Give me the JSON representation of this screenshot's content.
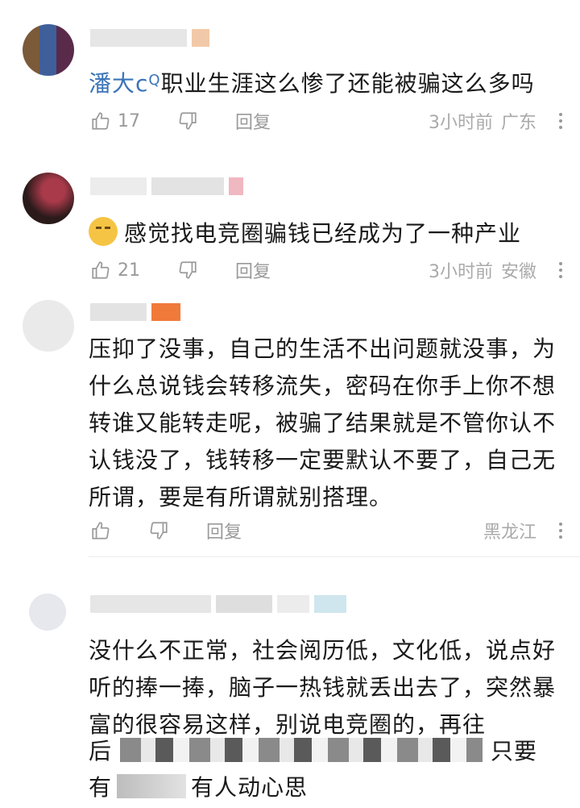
{
  "comments": [
    {
      "mention": "潘大c",
      "text": "职业生涯这么惨了还能被骗这么多吗",
      "likes": "17",
      "reply_label": "回复",
      "time": "3小时前",
      "location": "广东"
    },
    {
      "text": "感觉找电竞圈骗钱已经成为了一种产业",
      "likes": "21",
      "reply_label": "回复",
      "time": "3小时前",
      "location": "安徽"
    },
    {
      "text": "压抑了没事，自己的生活不出问题就没事，为什么总说钱会转移流失，密码在你手上你不想转谁又能转走呢，被骗了结果就是不管你认不认钱没了，钱转移一定要默认不要了，自己无所谓，要是有所谓就别搭理。",
      "reply_label": "回复",
      "location": "黑龙江"
    },
    {
      "text": "没什么不正常，社会阅历低，文化低，说点好听的捧一捧，脑子一热钱就丢出去了，突然暴富的很容易这样，别说电竞圈的，再往",
      "text_tail_a": "后",
      "text_tail_b": "只要",
      "text_last_a": "有",
      "text_last_b": "有人动心思"
    }
  ],
  "icons": [
    "thumbs-up-icon",
    "thumbs-down-icon",
    "more-vertical-icon"
  ],
  "colors": {
    "mention": "#3a74b8",
    "meta": "#9a9a9a"
  }
}
